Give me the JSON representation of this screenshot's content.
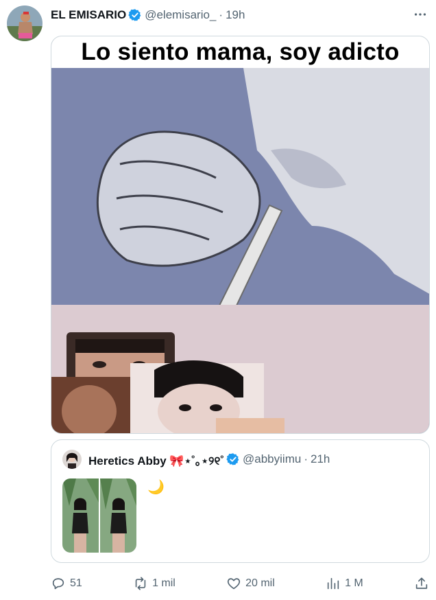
{
  "tweet": {
    "author_name": "EL EMISARIO",
    "author_handle": "@elemisario_",
    "separator": "·",
    "time": "19h",
    "media_caption": "Lo siento mama, soy adicto"
  },
  "quoted_tweet": {
    "author_name": "Heretics Abby 🎀⋆˚｡⋆୨୧˚",
    "author_handle": "@abbyiimu",
    "separator": "·",
    "time": "21h",
    "text": "🌙"
  },
  "actions": {
    "replies": "51",
    "reposts": "1 mil",
    "likes": "20 mil",
    "views": "1 M"
  },
  "colors": {
    "verified_blue": "#1d9bf0",
    "muted_text": "#536471",
    "border": "#cfd9de"
  },
  "icons": [
    "verified-icon",
    "more-icon",
    "reply-icon",
    "repost-icon",
    "like-icon",
    "views-icon",
    "share-icon"
  ]
}
